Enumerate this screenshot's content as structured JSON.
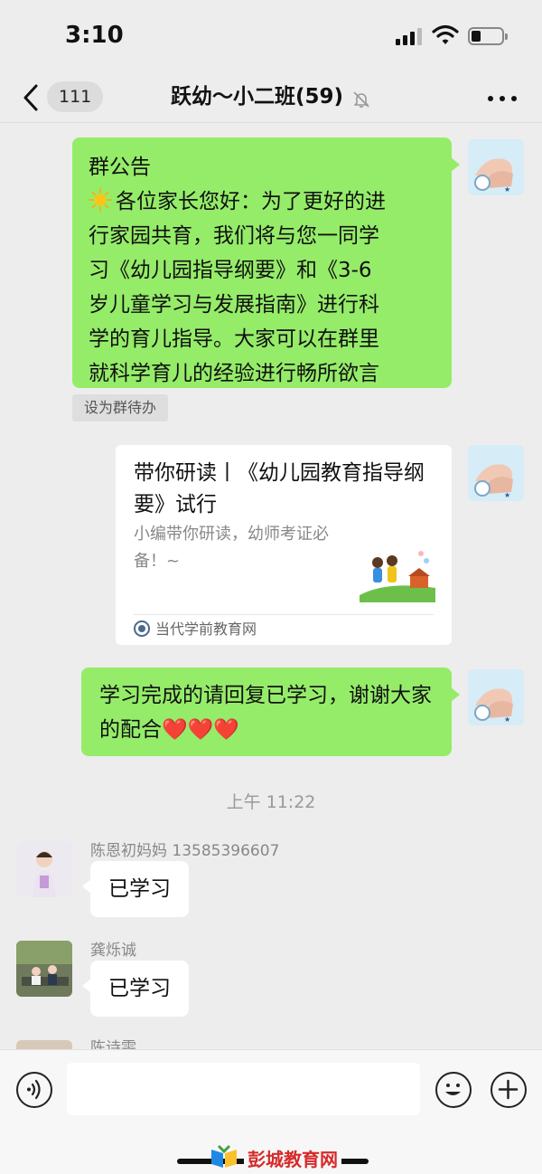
{
  "status_bar": {
    "time": "3:10"
  },
  "nav": {
    "unread_count": "111",
    "title": "跃幼～小二班(59)"
  },
  "messages": {
    "announcement": {
      "heading": "群公告",
      "lines": [
        "各位家长您好：为了更好的进",
        "行家园共育，我们将与您一同学",
        "习《幼儿园指导纲要》和《3-6",
        "岁儿童学习与发展指南》进行科",
        "学的育儿指导。大家可以在群里",
        "就科学育儿的经验进行畅所欲言"
      ],
      "todo_label": "设为群待办"
    },
    "link_card": {
      "title": "带你研读丨《幼儿园教育指导纲要》试行",
      "description": "小编带你研读，幼师考证必备！~",
      "source": "当代学前教育网"
    },
    "request": {
      "text": "学习完成的请回复已学习，谢谢大家的配合",
      "hearts": "❤️❤️❤️"
    },
    "timestamp": "上午 11:22",
    "replies": [
      {
        "sender": "陈恩初妈妈 13585396607",
        "text": "已学习"
      },
      {
        "sender": "龚烁诚",
        "text": "已学习"
      },
      {
        "sender": "陈诗雯"
      }
    ]
  },
  "watermark": {
    "text": "彭城教育网"
  },
  "colors": {
    "background": "#ededed",
    "my_bubble": "#95ec69",
    "other_bubble": "#ffffff",
    "watermark_red": "#d62a2a"
  },
  "icons": [
    "back-chevron-icon",
    "mute-bell-icon",
    "more-dots-icon",
    "sun-emoji-icon",
    "voice-icon",
    "emoji-icon",
    "plus-icon"
  ]
}
